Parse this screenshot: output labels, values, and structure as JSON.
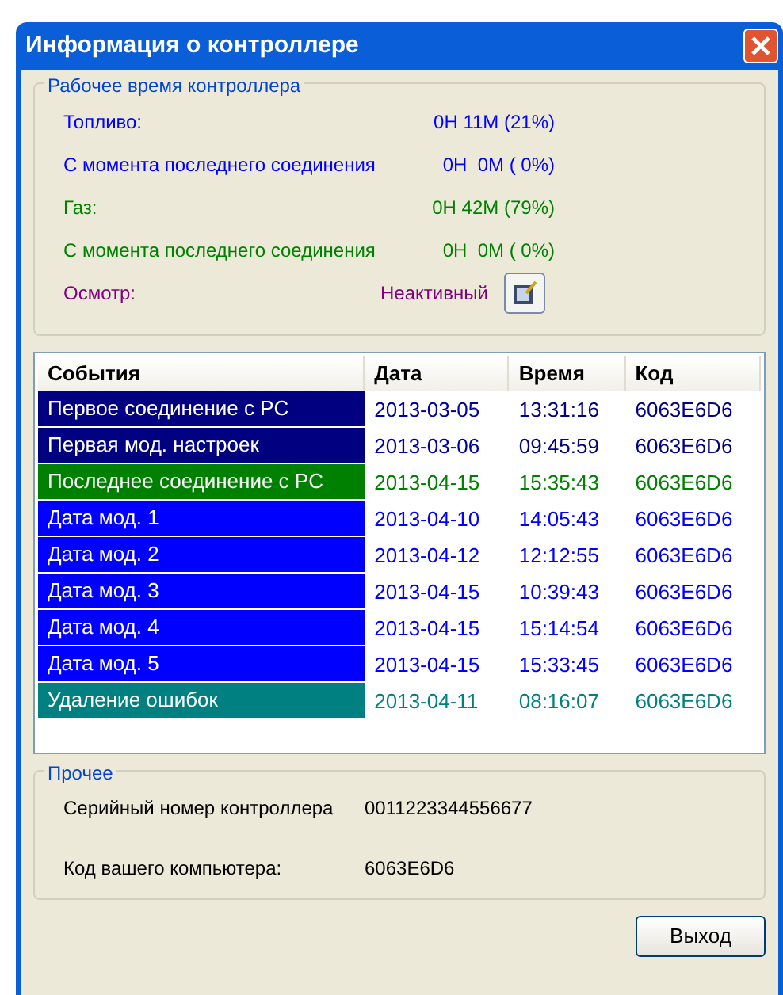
{
  "window": {
    "title": "Информация о контроллере"
  },
  "runtime": {
    "title": "Рабочее время контроллера",
    "rows": [
      {
        "kind": "text",
        "label": "Топливо:",
        "value": "0H 11M (21%)",
        "color": "#0000ff"
      },
      {
        "kind": "text",
        "label": "С момента последнего соединения",
        "value": "0H  0M ( 0%)",
        "color": "#0000ff"
      },
      {
        "kind": "text",
        "label": "Газ:",
        "value": "0H 42M (79%)",
        "color": "#008000"
      },
      {
        "kind": "text",
        "label": "С момента последнего соединения",
        "value": "0H  0M ( 0%)",
        "color": "#008000"
      },
      {
        "kind": "button",
        "label": "Осмотр:",
        "value": "Неактивный",
        "color": "#800080"
      }
    ]
  },
  "table": {
    "columns": [
      "События",
      "Дата",
      "Время",
      "Код"
    ],
    "rows": [
      {
        "event": "Первое соединение с PC",
        "date": "2013-03-05",
        "time": "13:31:16",
        "code": "6063E6D6",
        "color": "#000080"
      },
      {
        "event": "Первая мод. настроек",
        "date": "2013-03-06",
        "time": "09:45:59",
        "code": "6063E6D6",
        "color": "#000080"
      },
      {
        "event": "Последнее соединение с PC",
        "date": "2013-04-15",
        "time": "15:35:43",
        "code": "6063E6D6",
        "color": "#008000"
      },
      {
        "event": "Дата мод. 1",
        "date": "2013-04-10",
        "time": "14:05:43",
        "code": "6063E6D6",
        "color": "#0000ff"
      },
      {
        "event": "Дата мод. 2",
        "date": "2013-04-12",
        "time": "12:12:55",
        "code": "6063E6D6",
        "color": "#0000ff"
      },
      {
        "event": "Дата мод. 3",
        "date": "2013-04-15",
        "time": "10:39:43",
        "code": "6063E6D6",
        "color": "#0000ff"
      },
      {
        "event": "Дата мод. 4",
        "date": "2013-04-15",
        "time": "15:14:54",
        "code": "6063E6D6",
        "color": "#0000ff"
      },
      {
        "event": "Дата мод. 5",
        "date": "2013-04-15",
        "time": "15:33:45",
        "code": "6063E6D6",
        "color": "#0000ff"
      },
      {
        "event": "Удаление ошибок",
        "date": "2013-04-11",
        "time": "08:16:07",
        "code": "6063E6D6",
        "color": "#008080"
      }
    ]
  },
  "other": {
    "title": "Прочее",
    "rows": [
      {
        "label": "Серийный номер контроллера",
        "value": "0011223344556677"
      },
      {
        "label": "Код вашего компьютера:",
        "value": "6063E6D6"
      }
    ]
  },
  "buttons": [
    "Выход"
  ]
}
